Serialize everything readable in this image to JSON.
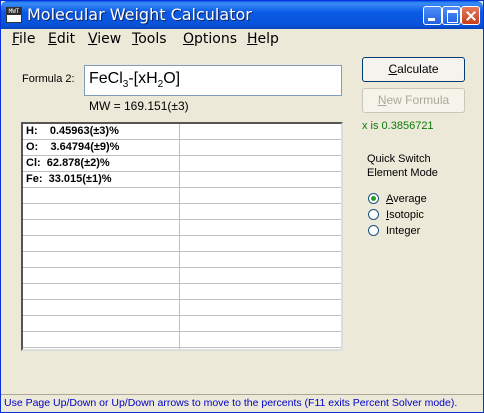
{
  "window": {
    "title": "Molecular Weight Calculator",
    "app_icon_text": "MWT"
  },
  "menu": [
    {
      "label": "File",
      "acc": "F",
      "rest": "ile"
    },
    {
      "label": "Edit",
      "acc": "E",
      "rest": "dit"
    },
    {
      "label": "View",
      "acc": "V",
      "rest": "iew"
    },
    {
      "label": "Tools",
      "acc": "T",
      "rest": "ools"
    },
    {
      "label": "Options",
      "acc": "O",
      "rest": "ptions"
    },
    {
      "label": "Help",
      "acc": "H",
      "rest": "elp"
    }
  ],
  "formula": {
    "label": "Formula 2:",
    "value_parts": [
      "FeCl",
      "3",
      "-[xH",
      "2",
      "O]"
    ],
    "mw": "MW = 169.151(±3)"
  },
  "results": [
    "H:    0.45963(±3)%",
    "O:    3.64794(±9)%",
    "Cl:  62.878(±2)%",
    "Fe:  33.015(±1)%",
    "",
    "",
    "",
    "",
    "",
    "",
    "",
    "",
    "",
    ""
  ],
  "buttons": {
    "calculate": {
      "acc": "C",
      "rest": "alculate"
    },
    "new_formula": {
      "acc": "N",
      "rest": "ew Formula"
    }
  },
  "solve_result": "x is 0.3856721",
  "quick_switch": {
    "label": "Quick Switch Element Mode",
    "options": [
      {
        "acc": "A",
        "rest": "verage",
        "selected": true
      },
      {
        "acc": "I",
        "rest": "sotopic",
        "selected": false
      },
      {
        "acc": "",
        "rest": "Integer",
        "selected": false
      }
    ]
  },
  "status": "Use Page Up/Down or Up/Down arrows to move to the percents (F11 exits Percent Solver mode).",
  "colors": {
    "titlebar": "#0b5be6",
    "status_text": "#0000c8",
    "solve_text": "#0a7a0a",
    "radio_dot": "#21a121"
  }
}
